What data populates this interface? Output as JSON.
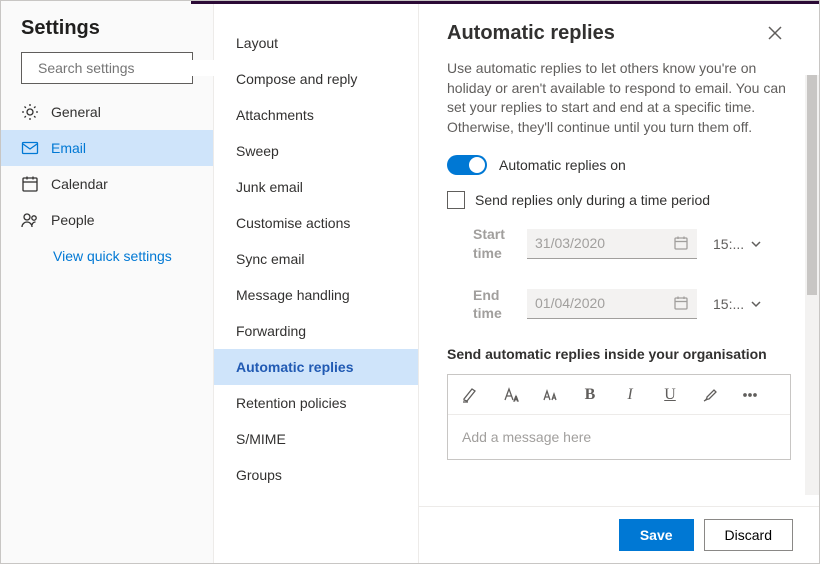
{
  "sidebar": {
    "title": "Settings",
    "search_placeholder": "Search settings",
    "nav": [
      {
        "label": "General",
        "active": false
      },
      {
        "label": "Email",
        "active": true
      },
      {
        "label": "Calendar",
        "active": false
      },
      {
        "label": "People",
        "active": false
      }
    ],
    "quick_link": "View quick settings"
  },
  "options": [
    {
      "label": "Layout"
    },
    {
      "label": "Compose and reply"
    },
    {
      "label": "Attachments"
    },
    {
      "label": "Sweep"
    },
    {
      "label": "Junk email"
    },
    {
      "label": "Customise actions"
    },
    {
      "label": "Sync email"
    },
    {
      "label": "Message handling"
    },
    {
      "label": "Forwarding"
    },
    {
      "label": "Automatic replies",
      "active": true
    },
    {
      "label": "Retention policies"
    },
    {
      "label": "S/MIME"
    },
    {
      "label": "Groups"
    }
  ],
  "main": {
    "title": "Automatic replies",
    "description": "Use automatic replies to let others know you're on holiday or aren't available to respond to email. You can set your replies to start and end at a specific time. Otherwise, they'll continue until you turn them off.",
    "toggle_label": "Automatic replies on",
    "checkbox_label": "Send replies only during a time period",
    "start_label": "Start time",
    "end_label": "End time",
    "start_date": "31/03/2020",
    "end_date": "01/04/2020",
    "start_time": "15:...",
    "end_time": "15:...",
    "section_label": "Send automatic replies inside your organisation",
    "editor_placeholder": "Add a message here",
    "save": "Save",
    "discard": "Discard"
  }
}
